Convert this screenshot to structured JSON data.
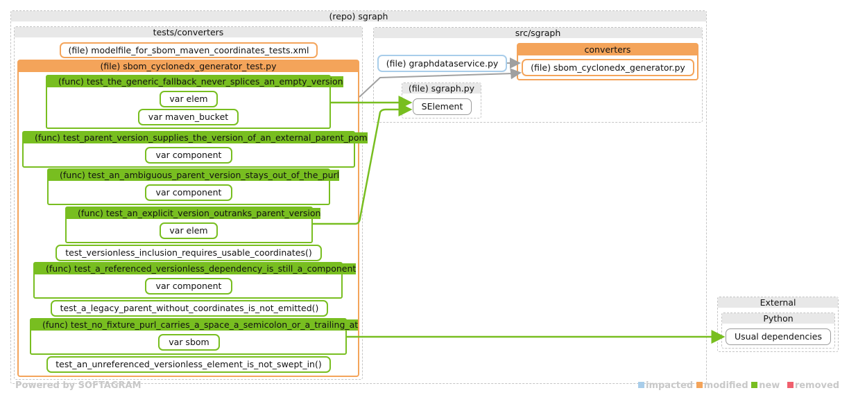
{
  "repo": {
    "title": "(repo) sgraph"
  },
  "tests_converters": {
    "title": "tests/converters",
    "xml_file": "(file) modelfile_for_sbom_maven_coordinates_tests.xml",
    "py_file": "(file) sbom_cyclonedx_generator_test.py",
    "funcs": [
      {
        "title": "(func) test_the_generic_fallback_never_splices_an_empty_version",
        "vars": [
          "var elem",
          "var maven_bucket"
        ]
      },
      {
        "title": "(func) test_parent_version_supplies_the_version_of_an_external_parent_pom",
        "vars": [
          "var component"
        ]
      },
      {
        "title": "(func) test_an_ambiguous_parent_version_stays_out_of_the_purl",
        "vars": [
          "var component"
        ]
      },
      {
        "title": "(func) test_an_explicit_version_outranks_parent_version",
        "vars": [
          "var elem"
        ]
      },
      {
        "title": "test_versionless_inclusion_requires_usable_coordinates()"
      },
      {
        "title": "(func) test_a_referenced_versionless_dependency_is_still_a_component",
        "vars": [
          "var component"
        ]
      },
      {
        "title": "test_a_legacy_parent_without_coordinates_is_not_emitted()"
      },
      {
        "title": "(func) test_no_fixture_purl_carries_a_space_a_semicolon_or_a_trailing_at",
        "vars": [
          "var sbom"
        ]
      },
      {
        "title": "test_an_unreferenced_versionless_element_is_not_swept_in()"
      }
    ]
  },
  "src_sgraph": {
    "title": "src/sgraph",
    "graphdataservice": "(file) graphdataservice.py",
    "converters": {
      "title": "converters",
      "file": "(file) sbom_cyclonedx_generator.py"
    },
    "sgraph_py": {
      "title": "(file) sgraph.py",
      "selement": "SElement"
    }
  },
  "external": {
    "title": "External",
    "python": {
      "title": "Python",
      "usual": "Usual dependencies"
    }
  },
  "footer": {
    "powered_by": "Powered by SOFTAGRAM",
    "legend": [
      {
        "label": "impacted",
        "color": "#a8cdea"
      },
      {
        "label": "modified",
        "color": "#f4a45a"
      },
      {
        "label": "new",
        "color": "#78be20"
      },
      {
        "label": "removed",
        "color": "#f0606e"
      }
    ]
  },
  "colors": {
    "new": "#78be20",
    "modified": "#f4a45a",
    "impacted": "#a8cdea",
    "edge_gray": "#a0a0a0"
  }
}
